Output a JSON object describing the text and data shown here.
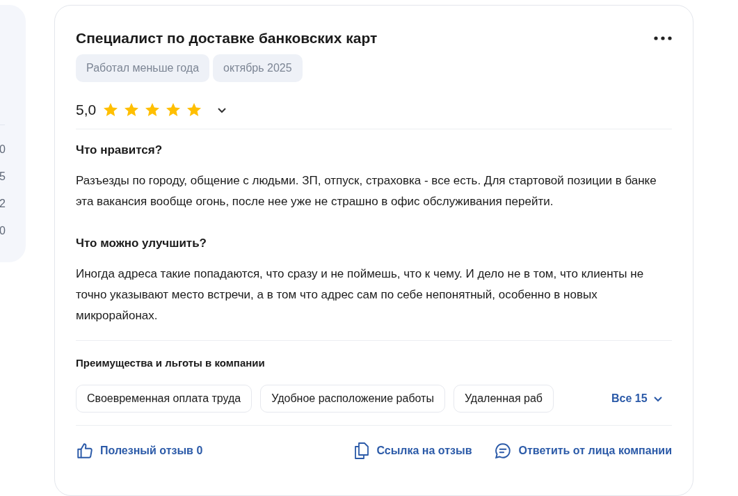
{
  "side_panel": {
    "values": [
      "0",
      "5",
      "2",
      "0"
    ]
  },
  "review": {
    "title": "Специалист по доставке банковских карт",
    "tags": [
      "Работал меньше года",
      "октябрь 2025"
    ],
    "rating": "5,0",
    "stars": 5,
    "sections": [
      {
        "heading": "Что нравится?",
        "text": "Разъезды по городу, общение с людьми. ЗП, отпуск, страховка - все есть. Для стартовой позиции в банке эта вакансия вообще огонь, после нее уже не страшно в офис обслуживания перейти."
      },
      {
        "heading": "Что можно улучшить?",
        "text": "Иногда адреса такие попадаются, что сразу и не поймешь, что к чему. И дело не в том, что клиенты не точно указывают место встречи, а в том что адрес сам по себе непонятный, особенно в новых микрорайонах."
      }
    ],
    "benefits": {
      "heading": "Преимущества и льготы в компании",
      "items": [
        "Своевременная оплата труда",
        "Удобное расположение работы",
        "Удаленная раб"
      ],
      "more": "Все 15"
    },
    "actions": [
      {
        "kind": "like",
        "label": "Полезный отзыв 0"
      },
      {
        "kind": "link",
        "label": "Ссылка на отзыв"
      },
      {
        "kind": "reply",
        "label": "Ответить от лица компании"
      }
    ]
  }
}
